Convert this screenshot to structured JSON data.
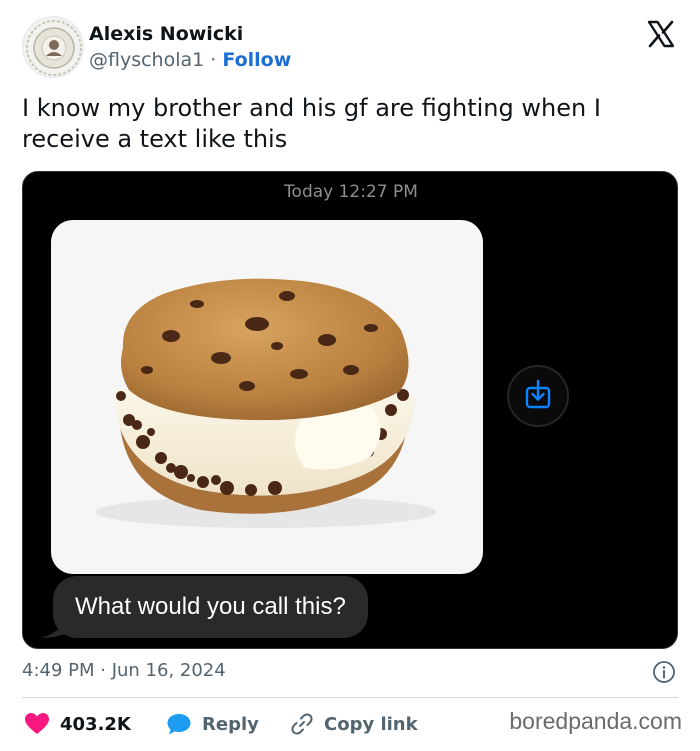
{
  "author": {
    "name": "Alexis Nowicki",
    "handle": "@flyschola1",
    "separator": "·",
    "follow_label": "Follow"
  },
  "tweet": {
    "text": "I know my brother and his gf are fighting when I receive a text like this",
    "timestamp": "4:49 PM · Jun 16, 2024"
  },
  "message_screenshot": {
    "time_label": "Today 12:27 PM",
    "image_subject": "ice cream cookie sandwich",
    "message_text": "What would you call this?"
  },
  "actions": {
    "likes_count": "403.2K",
    "reply_label": "Reply",
    "copy_link_label": "Copy link"
  },
  "watermark": "boredpanda.com",
  "icons": {
    "logo": "x-logo-icon",
    "save": "download-icon",
    "info": "info-icon",
    "like": "heart-icon",
    "reply": "chat-bubble-icon",
    "link": "link-icon"
  },
  "colors": {
    "follow": "#1d6fd6",
    "heart": "#f91880",
    "reply_bubble": "#1d9bf0",
    "message_bubble": "#2a2a2c",
    "save_icon": "#0a84ff"
  }
}
